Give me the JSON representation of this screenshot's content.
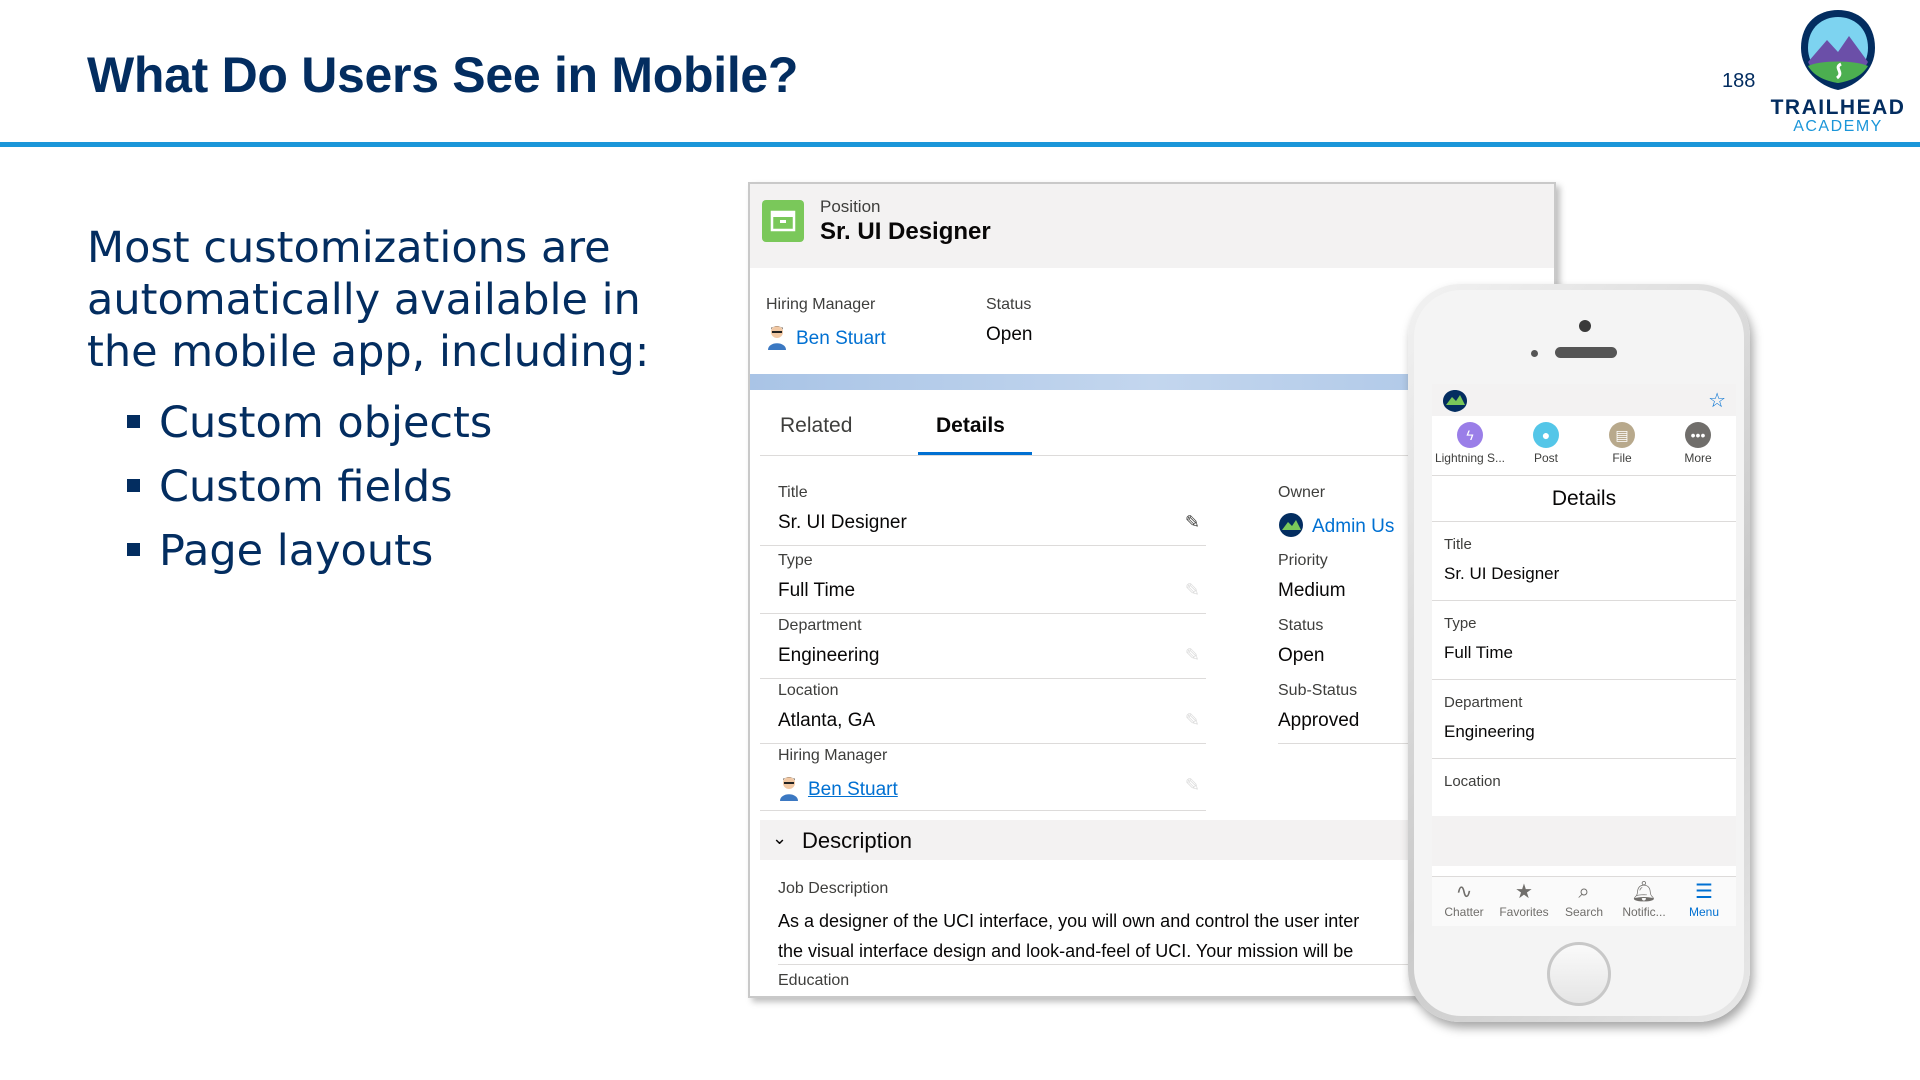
{
  "slide": {
    "title": "What Do Users See in Mobile?",
    "page_number": "188",
    "logo_line1": "TRAILHEAD",
    "logo_line2": "ACADEMY",
    "intro": "Most customizations are automatically available in the mobile app, including:",
    "bullets": [
      "Custom objects",
      "Custom fields",
      "Page layouts"
    ]
  },
  "desktop": {
    "object_type": "Position",
    "record_name": "Sr. UI Designer",
    "highlights": [
      {
        "label": "Hiring Manager",
        "value": "Ben Stuart"
      },
      {
        "label": "Status",
        "value": "Open"
      }
    ],
    "tabs": [
      "Related",
      "Details"
    ],
    "active_tab": "Details",
    "left_fields": [
      {
        "label": "Title",
        "value": "Sr. UI Designer"
      },
      {
        "label": "Type",
        "value": "Full Time"
      },
      {
        "label": "Department",
        "value": "Engineering"
      },
      {
        "label": "Location",
        "value": "Atlanta, GA"
      },
      {
        "label": "Hiring Manager",
        "value": "Ben Stuart"
      }
    ],
    "right_fields": [
      {
        "label": "Owner",
        "value": "Admin Us"
      },
      {
        "label": "Priority",
        "value": "Medium"
      },
      {
        "label": "Status",
        "value": "Open"
      },
      {
        "label": "Sub-Status",
        "value": "Approved"
      }
    ],
    "section_title": "Description",
    "job_description_label": "Job Description",
    "job_description_line1": "As a designer of the UCI interface, you will own and control the user inter",
    "job_description_line2": "the visual interface design and look-and-feel of UCI. Your mission will be",
    "education_label": "Education"
  },
  "mobile": {
    "actions": [
      {
        "label": "Lightning S...",
        "color": "#9a7ee8"
      },
      {
        "label": "Post",
        "color": "#54c6e8"
      },
      {
        "label": "File",
        "color": "#b8a98c"
      },
      {
        "label": "More",
        "color": "#706e6b"
      }
    ],
    "heading": "Details",
    "fields": [
      {
        "label": "Title",
        "value": "Sr. UI Designer"
      },
      {
        "label": "Type",
        "value": "Full Time"
      },
      {
        "label": "Department",
        "value": "Engineering"
      },
      {
        "label": "Location",
        "value": ""
      }
    ],
    "nav": [
      {
        "label": "Chatter",
        "icon": "pulse-icon"
      },
      {
        "label": "Favorites",
        "icon": "star-icon"
      },
      {
        "label": "Search",
        "icon": "search-icon"
      },
      {
        "label": "Notific...",
        "icon": "bell-icon"
      },
      {
        "label": "Menu",
        "icon": "menu-icon"
      }
    ]
  },
  "colors": {
    "navy": "#032d60",
    "accent_blue": "#1b96d9",
    "link_blue": "#0070d2",
    "object_green": "#7ac85a"
  }
}
